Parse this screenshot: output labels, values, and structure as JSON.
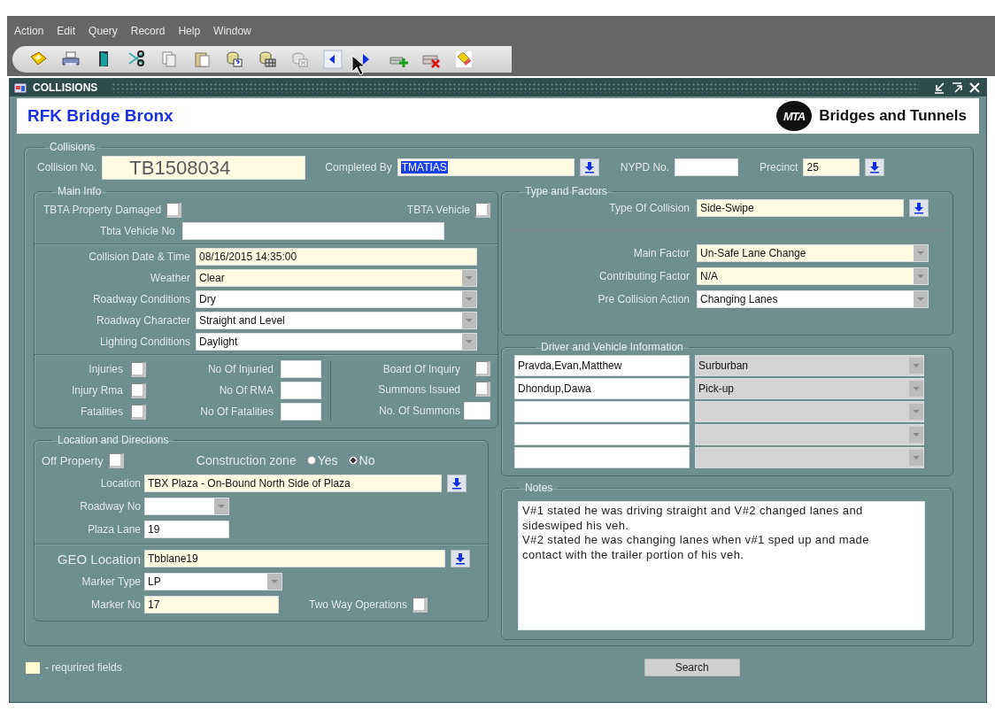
{
  "menu": [
    "Action",
    "Edit",
    "Query",
    "Record",
    "Help",
    "Window"
  ],
  "window": {
    "title": "COLLISIONS"
  },
  "header": {
    "title": "RFK Bridge Bronx",
    "logo_text": "MTA",
    "brand": "Bridges and Tunnels"
  },
  "collisions": {
    "legend": "Collisions",
    "fields": [
      {
        "label": "Collision No.",
        "value": "TB1508034",
        "kind": "text",
        "required": true
      },
      {
        "label": "Completed By",
        "value": "TMATIAS",
        "kind": "lov",
        "required": true,
        "highlighted": true
      },
      {
        "label": "NYPD No.",
        "kind": "text",
        "required": false
      },
      {
        "label": "Precinct",
        "value": "25",
        "kind": "lov",
        "required": true
      }
    ]
  },
  "main_info": {
    "legend": "Main Info",
    "property_damaged": {
      "label": "TBTA Property Damaged",
      "checked": false
    },
    "tbta_vehicle": {
      "label": "TBTA Vehicle",
      "checked": false
    },
    "vehicle_no": {
      "label": "Tbta Vehicle No",
      "kind": "text",
      "required": false
    },
    "conditions": [
      {
        "label": "Collision Date & Time",
        "value": "08/16/2015 14:35:00",
        "kind": "text",
        "required": true
      },
      {
        "label": "Weather",
        "value": "Clear",
        "kind": "combo",
        "required": true
      },
      {
        "label": "Roadway Conditions",
        "value": "Dry",
        "kind": "combo",
        "required": false
      },
      {
        "label": "Roadway Character",
        "value": "Straight and Level",
        "kind": "combo",
        "required": false
      },
      {
        "label": "Lighting Conditions",
        "value": "Daylight",
        "kind": "combo",
        "required": false
      }
    ],
    "flags": [
      {
        "label": "Injuries",
        "checked": false
      },
      {
        "label": "Injury Rma",
        "checked": false
      },
      {
        "label": "Fatalities",
        "checked": false
      }
    ],
    "counts": [
      {
        "label": "No Of Injuried",
        "kind": "text",
        "required": false
      },
      {
        "label": "No Of RMA",
        "kind": "text",
        "required": false
      },
      {
        "label": "No Of Fatalities",
        "kind": "text",
        "required": false
      }
    ],
    "board_of_inquiry": {
      "label": "Board Of Inquiry",
      "checked": false
    },
    "summons_issued": {
      "label": "Summons Issued",
      "checked": false
    },
    "summons_count": {
      "label": "No. Of Summons",
      "kind": "text",
      "required": false
    }
  },
  "location": {
    "legend": "Location and Directions",
    "off_property": {
      "label": "Off Property",
      "checked": false
    },
    "construction_zone": {
      "label": "Construction zone",
      "options": [
        {
          "label": "Yes",
          "selected": false
        },
        {
          "label": "No",
          "selected": true
        }
      ]
    },
    "fields": [
      {
        "label": "Location",
        "value": "TBX Plaza - On-Bound North Side of Plaza",
        "kind": "lov",
        "required": true
      },
      {
        "label": "Roadway No",
        "kind": "combo",
        "required": false
      },
      {
        "label": "Plaza Lane",
        "value": "19",
        "kind": "text",
        "required": false
      }
    ],
    "geo": [
      {
        "label": "GEO Location",
        "value": "Tbblane19",
        "kind": "lov",
        "required": true
      },
      {
        "label": "Marker Type",
        "value": "LP",
        "kind": "combo",
        "required": false
      },
      {
        "label": "Marker No",
        "value": "17",
        "kind": "text",
        "required": true
      }
    ],
    "two_way": {
      "label": "Two Way Operations",
      "checked": false
    }
  },
  "type_factors": {
    "legend": "Type and Factors",
    "type": {
      "label": "Type Of Collision",
      "value": "Side-Swipe",
      "kind": "lov",
      "required": true
    },
    "factors": [
      {
        "label": "Main Factor",
        "value": "Un-Safe Lane Change",
        "kind": "combo",
        "required": true
      },
      {
        "label": "Contributing Factor",
        "value": "N/A",
        "kind": "combo",
        "required": true
      },
      {
        "label": "Pre Collision Action",
        "value": "Changing Lanes",
        "kind": "combo",
        "required": false
      }
    ]
  },
  "drivers": {
    "legend": "Driver and Vehicle Information",
    "rows": [
      {
        "kind": "filled",
        "name": "Pravda,Evan,Matthew",
        "vehicle": "Surburban"
      },
      {
        "kind": "filled",
        "name": "Dhondup,Dawa",
        "vehicle": "Pick-up"
      },
      {
        "kind": "empty"
      },
      {
        "kind": "empty"
      },
      {
        "kind": "empty"
      }
    ]
  },
  "notes": {
    "legend": "Notes",
    "paragraphs": [
      "V#1 stated he was driving straight and V#2 changed lanes and sideswiped his veh.",
      "V#2 stated he was changing lanes when v#1 sped up and made contact with the trailer portion of his veh."
    ]
  },
  "footer": {
    "legend_text": "- requrired fields",
    "search": "Search"
  }
}
